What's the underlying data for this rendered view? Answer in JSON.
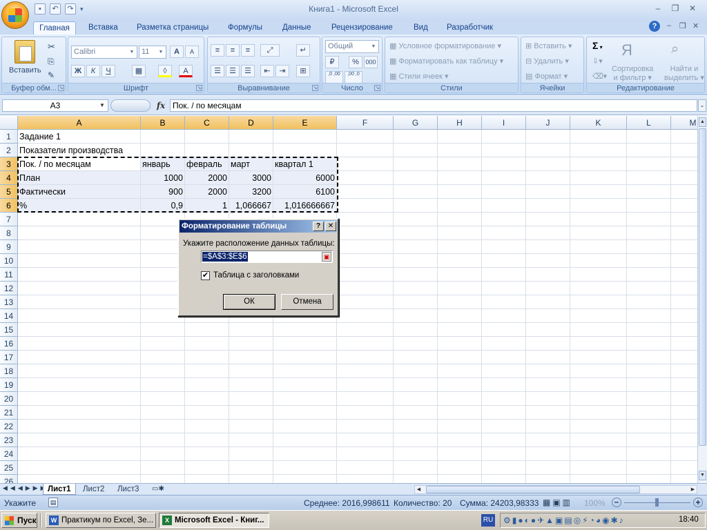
{
  "window": {
    "title": "Книга1 - Microsoft Excel"
  },
  "tabs": [
    "Главная",
    "Вставка",
    "Разметка страницы",
    "Формулы",
    "Данные",
    "Рецензирование",
    "Вид",
    "Разработчик"
  ],
  "ribbon": {
    "clipboard": {
      "label": "Буфер обм...",
      "paste": "Вставить"
    },
    "font": {
      "label": "Шрифт",
      "name": "Calibri",
      "size": "11",
      "bold": "Ж",
      "italic": "К",
      "underline": "Ч",
      "grow": "A",
      "shrink": "A",
      "color": "A"
    },
    "alignment": {
      "label": "Выравнивание"
    },
    "number": {
      "label": "Число",
      "format": "Общий",
      "percent": "%",
      "thousands": "000",
      "inc_dec": ",0 ,00",
      "dec_dec": ",00 ,0"
    },
    "styles": {
      "label": "Стили",
      "cond": "Условное форматирование",
      "table": "Форматировать как таблицу",
      "cell": "Стили ячеек"
    },
    "cells": {
      "label": "Ячейки",
      "insert": "Вставить",
      "delete": "Удалить",
      "format": "Формат"
    },
    "editing": {
      "label": "Редактирование",
      "sigma": "Σ",
      "sort1": "Сортировка",
      "sort2": "и фильтр",
      "find1": "Найти и",
      "find2": "выделить"
    }
  },
  "formula_bar": {
    "name": "A3",
    "fx": "fx",
    "value": "Пок. / по месяцам"
  },
  "columns": [
    "A",
    "B",
    "C",
    "D",
    "E",
    "F",
    "G",
    "H",
    "I",
    "J",
    "K",
    "L",
    "M"
  ],
  "rows": [
    "1",
    "2",
    "3",
    "4",
    "5",
    "6",
    "7",
    "8",
    "9",
    "10",
    "11",
    "12",
    "13",
    "14",
    "15",
    "16",
    "17",
    "18",
    "19",
    "20",
    "21",
    "22",
    "23",
    "24",
    "25",
    "26"
  ],
  "cells": {
    "a1": "Задание 1",
    "a2": "Показатели производства",
    "header": [
      "Пок. / по месяцам",
      "январь",
      "февраль",
      "март",
      "квартал 1"
    ],
    "row4": [
      "План",
      "1000",
      "2000",
      "3000",
      "6000"
    ],
    "row5": [
      "Фактически",
      "900",
      "2000",
      "3200",
      "6100"
    ],
    "row6": [
      "%",
      "0,9",
      "1",
      "1,066667",
      "1,016666667"
    ]
  },
  "sheets": [
    "Лист1",
    "Лист2",
    "Лист3"
  ],
  "status": {
    "mode": "Укажите",
    "avg": "Среднее: 2016,998611",
    "count": "Количество: 20",
    "sum": "Сумма: 24203,98333",
    "zoom": "100%"
  },
  "dialog": {
    "title": "Форматирование таблицы",
    "help": "?",
    "close": "✕",
    "prompt": "Укажите расположение данных таблицы:",
    "range": "=$A$3:$E$6",
    "checkbox": "Таблица с заголовками",
    "checked": true,
    "ok": "ОК",
    "cancel": "Отмена"
  },
  "taskbar": {
    "start": "Пуск",
    "task1": "Практикум по Excel, Зе...",
    "task2": "Microsoft Excel - Книг...",
    "lang": "RU",
    "clock": "18:40"
  }
}
